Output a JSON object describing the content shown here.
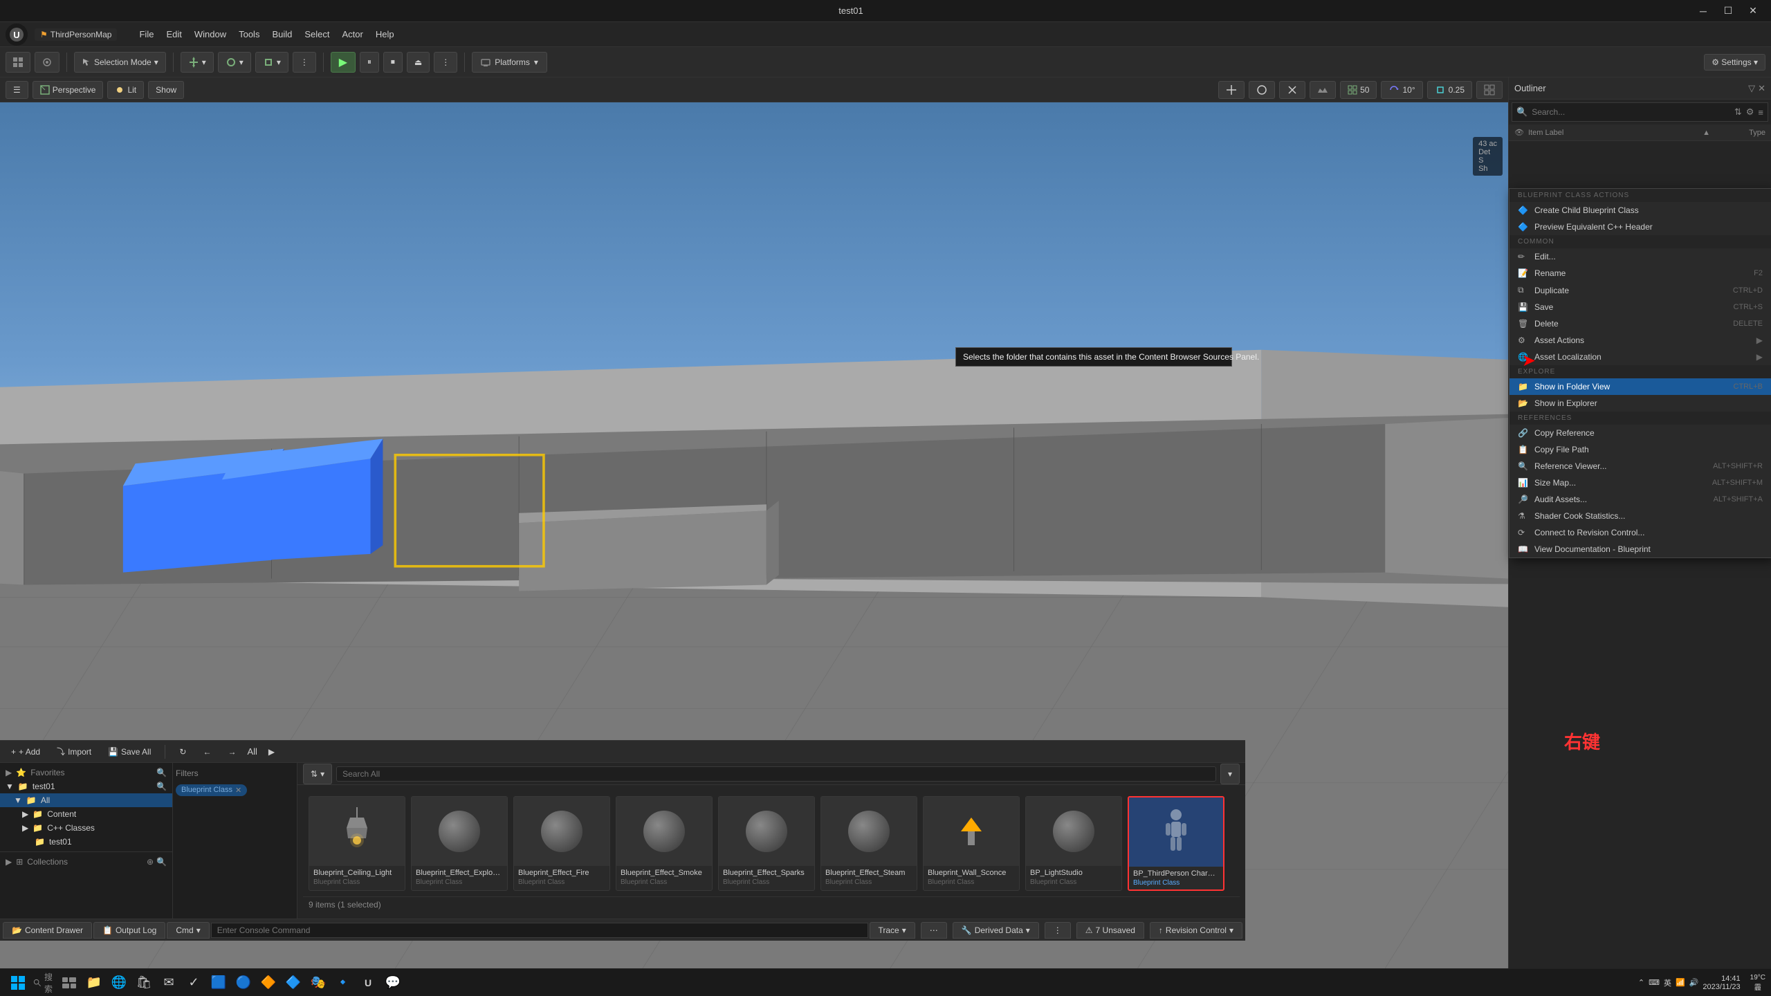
{
  "window": {
    "title": "test01",
    "map_name": "ThirdPersonMap"
  },
  "menu": {
    "file": "File",
    "edit": "Edit",
    "window": "Window",
    "tools": "Tools",
    "build": "Build",
    "select": "Select",
    "actor": "Actor",
    "help": "Help"
  },
  "toolbar": {
    "selection_mode": "Selection Mode",
    "platforms": "Platforms",
    "settings": "⚙ Settings ▾"
  },
  "viewport": {
    "mode": "Perspective",
    "lighting": "Lit",
    "show": "Show",
    "grid_size": "50",
    "rotation_snap": "10°",
    "scale_snap": "0.25",
    "viewport_num": "1"
  },
  "outliner": {
    "title": "Outliner",
    "search_placeholder": "Search...",
    "column_label": "Item Label",
    "column_type": "Type"
  },
  "context_menu": {
    "blueprint_section": "BLUEPRINT CLASS ACTIONS",
    "create_child": "Create Child Blueprint Class",
    "preview_cpp": "Preview Equivalent C++ Header",
    "common_section": "COMMON",
    "edit": "Edit...",
    "rename": "Rename",
    "rename_shortcut": "F2",
    "duplicate": "Duplicate",
    "duplicate_shortcut": "CTRL+D",
    "save": "Save",
    "save_shortcut": "CTRL+S",
    "delete": "Delete",
    "delete_shortcut": "DELETE",
    "asset_actions": "Asset Actions",
    "asset_localization": "Asset Localization",
    "explore_section": "EXPLORE",
    "show_folder_view": "Show in Folder View",
    "show_folder_shortcut": "CTRL+B",
    "show_explorer": "Show in Explorer",
    "references_section": "REFERENCES",
    "copy_reference": "Copy Reference",
    "copy_file_path": "Copy File Path",
    "reference_viewer": "Reference Viewer...",
    "reference_viewer_shortcut": "ALT+SHIFT+R",
    "size_map": "Size Map...",
    "size_map_shortcut": "ALT+SHIFT+M",
    "audit_assets": "Audit Assets...",
    "audit_assets_shortcut": "ALT+SHIFT+A",
    "shader_cook": "Shader Cook Statistics...",
    "connect_revision": "Connect to Revision Control...",
    "view_documentation": "View Documentation - Blueprint"
  },
  "tooltip": {
    "text": "Selects the folder that contains this asset in the Content Browser Sources Panel."
  },
  "content_browser": {
    "add_btn": "+ Add",
    "import_btn": "Import",
    "save_all_btn": "Save All",
    "path": "All",
    "filters_label": "Filters",
    "filter_tag": "Blueprint Class",
    "search_placeholder": "Search All",
    "status": "9 items (1 selected)"
  },
  "source_tree": {
    "favorites": "Favorites",
    "project": "test01",
    "all": "All",
    "content": "Content",
    "cpp_classes": "C++ Classes",
    "test01_sub": "test01",
    "collections": "Collections"
  },
  "assets": [
    {
      "name": "Blueprint_Ceiling_Light",
      "type": "Blueprint Class",
      "thumb": "ceiling_light"
    },
    {
      "name": "Blueprint_Effect_Explosion",
      "type": "Blueprint Class",
      "thumb": "sphere"
    },
    {
      "name": "Blueprint_Effect_Fire",
      "type": "Blueprint Class",
      "thumb": "sphere"
    },
    {
      "name": "Blueprint_Effect_Smoke",
      "type": "Blueprint Class",
      "thumb": "sphere"
    },
    {
      "name": "Blueprint_Effect_Sparks",
      "type": "Blueprint Class",
      "thumb": "sphere"
    },
    {
      "name": "Blueprint_Effect_Steam",
      "type": "Blueprint Class",
      "thumb": "sphere"
    },
    {
      "name": "Blueprint_Wall_Sconce",
      "type": "Blueprint Class",
      "thumb": "wall_sconce"
    },
    {
      "name": "BP_LightStudio",
      "type": "Blueprint Class",
      "thumb": "sphere"
    },
    {
      "name": "BP_ThirdPerson Character",
      "type": "Blueprint Class",
      "thumb": "character",
      "selected": true
    }
  ],
  "status_bar": {
    "content_drawer": "Content Drawer",
    "output_log": "Output Log",
    "cmd_label": "Cmd",
    "cmd_placeholder": "Enter Console Command",
    "trace": "Trace",
    "derived_data": "Derived Data",
    "unsaved": "7 Unsaved",
    "revision_control": "Revision Control"
  },
  "taskbar": {
    "time": "14:41",
    "date": "2023/11/23",
    "search_placeholder": "搜索",
    "temperature": "19°C",
    "weather": "霾"
  },
  "annotation": {
    "right_click_cn": "右键"
  }
}
